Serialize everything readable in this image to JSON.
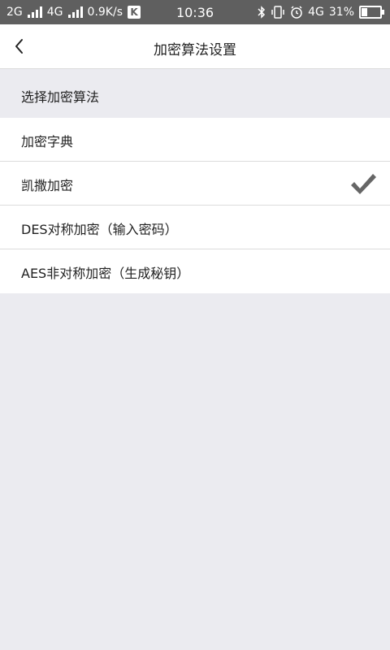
{
  "status_bar": {
    "net1": "2G",
    "net2": "4G",
    "speed": "0.9K/s",
    "k_badge": "K",
    "time": "10:36",
    "volte": "4G",
    "battery": "31%",
    "battery_level": 0.31
  },
  "nav": {
    "back_icon": "chevron-left-icon",
    "title": "加密算法设置"
  },
  "section": {
    "title": "选择加密算法"
  },
  "options": [
    {
      "label": "加密字典",
      "selected": false
    },
    {
      "label": "凯撒加密",
      "selected": true
    },
    {
      "label": "DES对称加密（输入密码）",
      "selected": false
    },
    {
      "label": "AES非对称加密（生成秘钥）",
      "selected": false
    }
  ],
  "colors": {
    "status_bar": "#5f5f5f",
    "background": "#ebebf0",
    "check": "#666666"
  }
}
